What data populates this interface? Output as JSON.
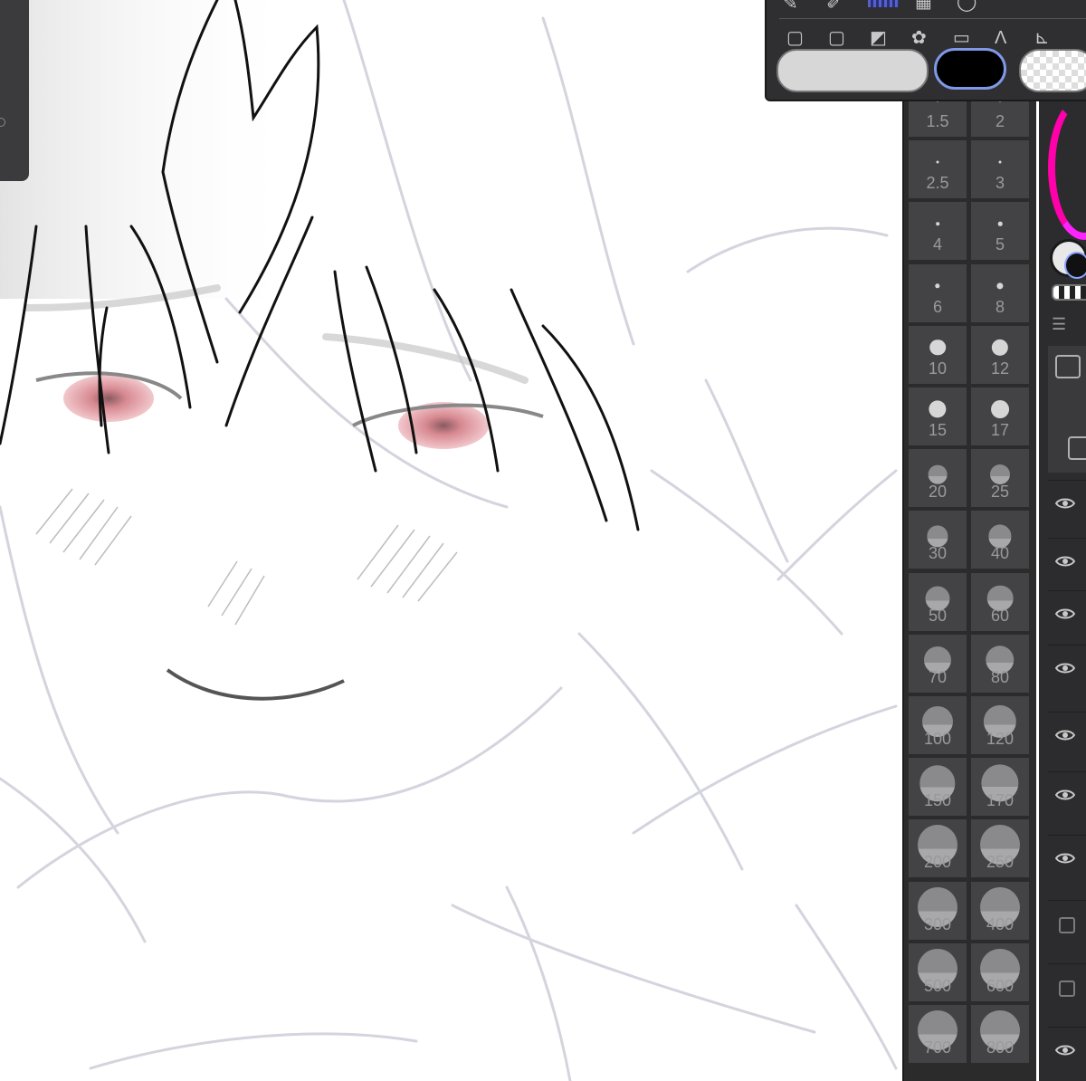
{
  "brush_sizes": [
    "1.5",
    "2",
    "2.5",
    "3",
    "4",
    "5",
    "6",
    "8",
    "10",
    "12",
    "15",
    "17",
    "20",
    "25",
    "30",
    "40",
    "50",
    "60",
    "70",
    "80",
    "100",
    "120",
    "150",
    "170",
    "200",
    "250",
    "300",
    "400",
    "500",
    "600",
    "700",
    "800"
  ],
  "colors": {
    "canvas_bg": "#ffffff",
    "panel_bg": "#2b2b2c",
    "cell_bg": "#434345",
    "accent_ring": "#ff00aa",
    "main_color": "#000000",
    "sub_color": "#d7d7d7",
    "eye_tint": "#d88a92"
  },
  "layers": {
    "menu_icon": "☰",
    "rows": [
      {
        "visible": true
      },
      {
        "visible": true
      },
      {
        "visible": true
      },
      {
        "visible": true
      },
      {
        "visible": true
      },
      {
        "visible": true
      },
      {
        "visible": true
      },
      {
        "visible": false
      },
      {
        "visible": false
      },
      {
        "visible": true
      }
    ]
  },
  "tool_popup": {
    "swatches": [
      "gray",
      "black",
      "transparent"
    ]
  }
}
